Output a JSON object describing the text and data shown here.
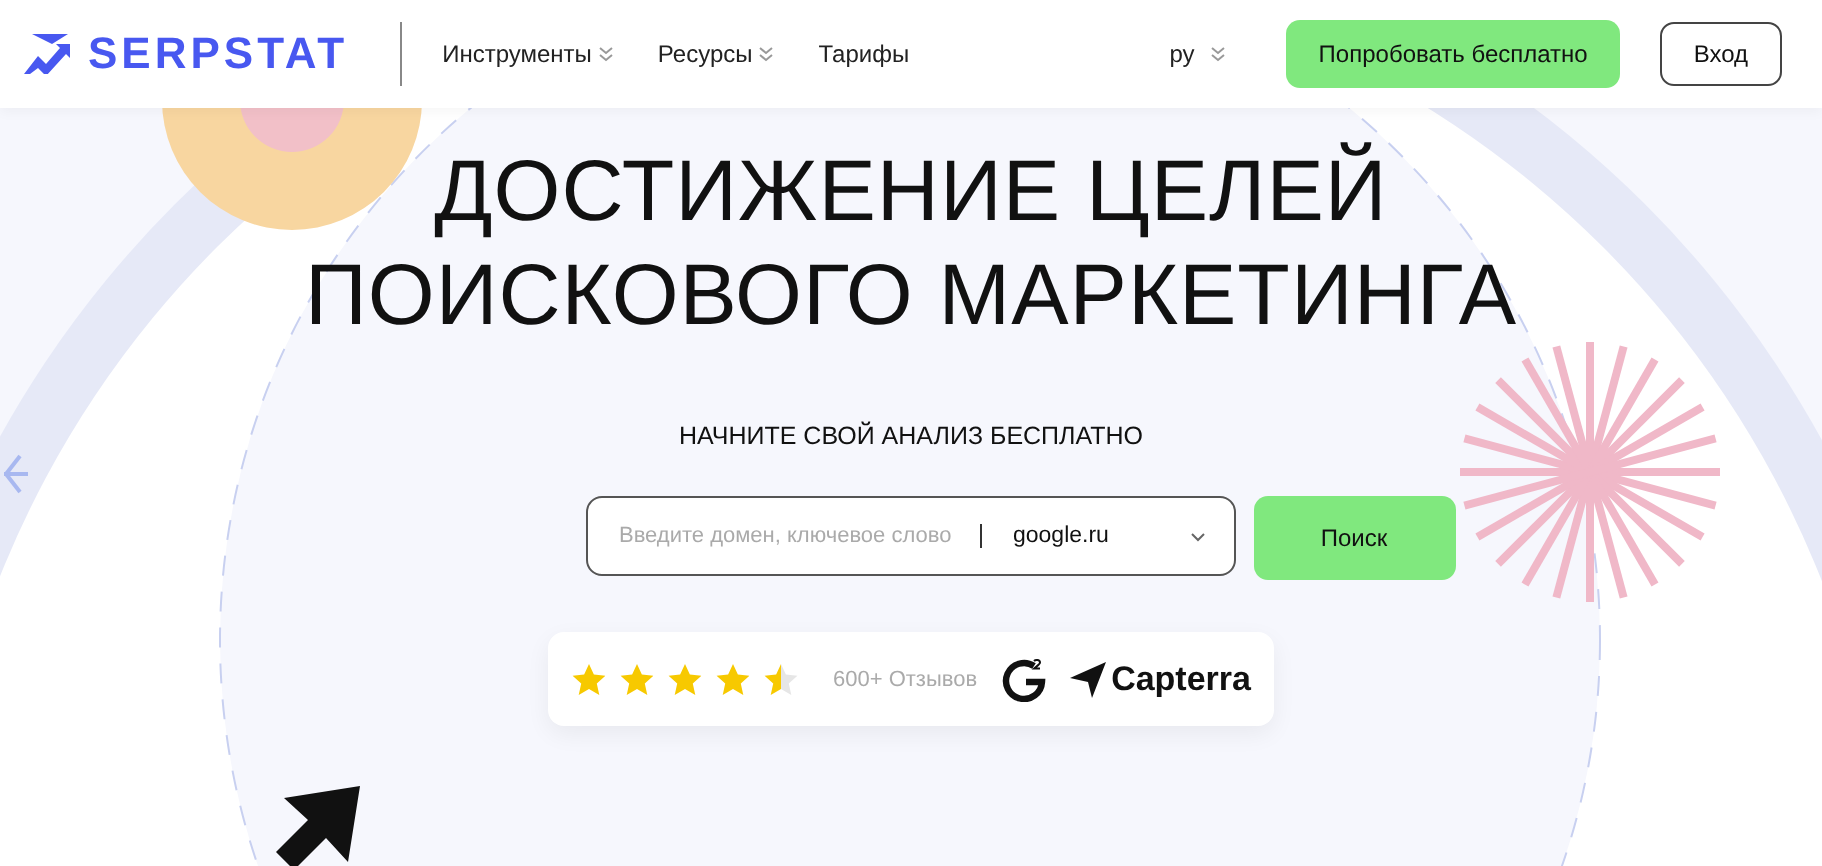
{
  "header": {
    "logo": "SERPSTAT",
    "nav": [
      {
        "label": "Инструменты",
        "dropdown": true
      },
      {
        "label": "Ресурсы",
        "dropdown": true
      },
      {
        "label": "Тарифы",
        "dropdown": false
      }
    ],
    "language": "ру",
    "buttons": [
      {
        "label": "Попробовать бесплатно",
        "kind": "primary"
      },
      {
        "label": "Вход",
        "kind": "outline"
      }
    ]
  },
  "hero": {
    "title": [
      "ДОСТИЖЕНИЕ ЦЕЛЕЙ",
      "ПОИСКОВОГО МАРКЕТИНГА"
    ],
    "subtitle": "НАЧНИТЕ СВОЙ АНАЛИЗ БЕСПЛАТНО",
    "search": {
      "placeholder": "Введите домен, ключевое слово",
      "engine": "google.ru",
      "button": "Поиск"
    },
    "reviews": {
      "stars": 4.5,
      "count": "600+ Отзывов",
      "capterra": "Capterra"
    }
  }
}
